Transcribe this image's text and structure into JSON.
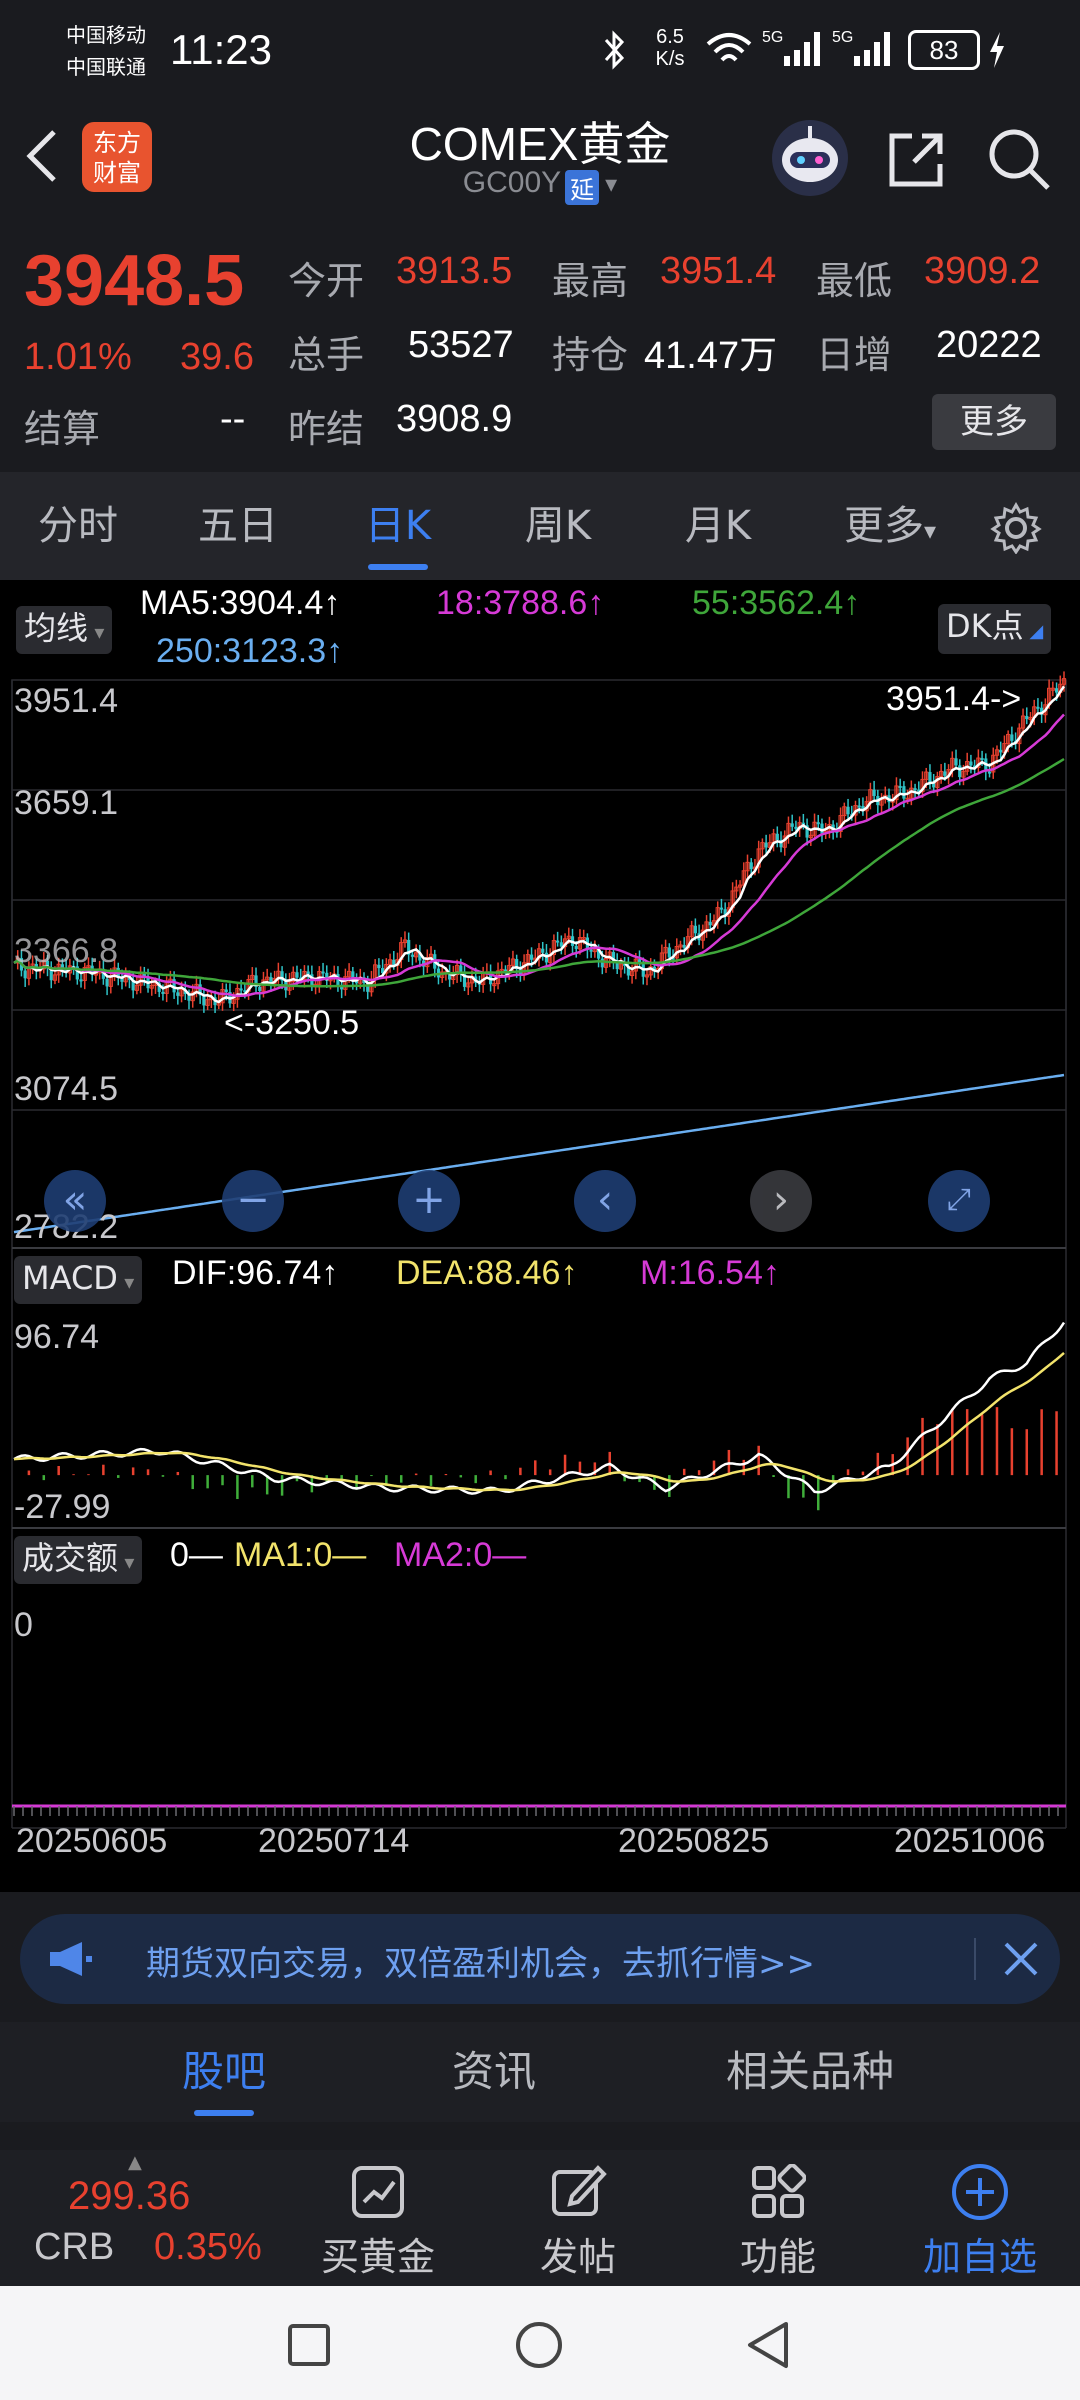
{
  "status": {
    "carrier1": "中国移动",
    "carrier2": "中国联通",
    "time": "11:23",
    "net_speed_top": "6.5",
    "net_speed_unit": "K/s",
    "battery": "83"
  },
  "header": {
    "logo_top": "东方",
    "logo_bottom": "财富",
    "title": "COMEX黄金",
    "code": "GC00Y",
    "delay_tag": "延"
  },
  "quote": {
    "price": "3948.5",
    "change_pct": "1.01%",
    "change_val": "39.6",
    "open_label": "今开",
    "open": "3913.5",
    "high_label": "最高",
    "high": "3951.4",
    "low_label": "最低",
    "low": "3909.2",
    "volume_label": "总手",
    "volume": "53527",
    "oi_label": "持仓",
    "oi": "41.47万",
    "inc_label": "日增",
    "inc": "20222",
    "settle_label": "结算",
    "settle": "--",
    "prev_label": "昨结",
    "prev": "3908.9",
    "more": "更多"
  },
  "tabs": [
    "分时",
    "五日",
    "日K",
    "周K",
    "月K",
    "更多"
  ],
  "chart": {
    "ma_toggle": "均线",
    "ma5": "MA5:3904.4↑",
    "ma18": "18:3788.6↑",
    "ma55": "55:3562.4↑",
    "ma250": "250:3123.3↑",
    "dk": "DK点",
    "y_ticks": [
      "3951.4",
      "3659.1",
      "3366.8",
      "3074.5",
      "2782.2"
    ],
    "max_label": "3951.4->",
    "min_label": "<-3250.5",
    "macd_toggle": "MACD",
    "dif": "DIF:96.74↑",
    "dea": "DEA:88.46↑",
    "m": "M:16.54↑",
    "macd_max": "96.74",
    "macd_min": "-27.99",
    "vol_toggle": "成交额",
    "vol0": "0—",
    "vma1": "MA1:0—",
    "vma2": "MA2:0—",
    "vol_axis": "0",
    "dates": [
      "20250605",
      "20250714",
      "20250825",
      "20251006"
    ],
    "colors": {
      "up": "#e8412f",
      "down": "#2fc3c8",
      "ma5": "#ffffff",
      "ma18": "#d63ad6",
      "ma55": "#3fa63a",
      "ma250": "#6aaef0",
      "dea": "#f2e36b",
      "macd_up": "#e8412f",
      "macd_down": "#3fae3a"
    }
  },
  "ad": {
    "text": "期货双向交易，双倍盈利机会，去抓行情>>"
  },
  "lowtabs": [
    "股吧",
    "资讯",
    "相关品种"
  ],
  "actions": {
    "crb_value": "299.36",
    "crb_label": "CRB",
    "crb_pct": "0.35%",
    "items": [
      "买黄金",
      "发帖",
      "功能",
      "加自选"
    ]
  }
}
